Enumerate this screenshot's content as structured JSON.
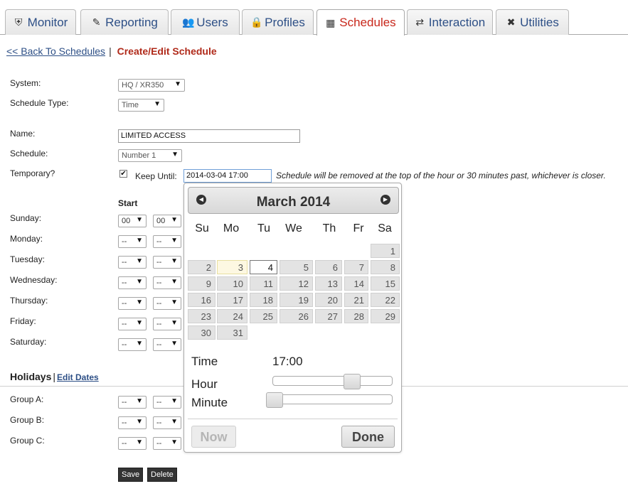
{
  "tabs": [
    {
      "label": "Monitor",
      "icon": "shield-icon",
      "glyph": "⛨",
      "active": false
    },
    {
      "label": "Reporting",
      "icon": "reporting-icon",
      "glyph": "✎",
      "active": false
    },
    {
      "label": "Users",
      "icon": "users-icon",
      "glyph": "👥",
      "active": false
    },
    {
      "label": "Profiles",
      "icon": "lock-icon",
      "glyph": "🔒",
      "active": false
    },
    {
      "label": "Schedules",
      "icon": "calendar-icon",
      "glyph": "▦",
      "active": true
    },
    {
      "label": "Interaction",
      "icon": "interaction-icon",
      "glyph": "⇄",
      "active": false
    },
    {
      "label": "Utilities",
      "icon": "tools-icon",
      "glyph": "✖",
      "active": false
    }
  ],
  "breadcrumb": {
    "back": "<< Back To Schedules",
    "separator": "|",
    "current": "Create/Edit Schedule"
  },
  "form": {
    "system_label": "System:",
    "system_value": "HQ / XR350",
    "type_label": "Schedule Type:",
    "type_value": "Time",
    "name_label": "Name:",
    "name_value": "LIMITED ACCESS",
    "schedule_label": "Schedule:",
    "schedule_value": "Number 1",
    "temporary_label": "Temporary?",
    "temporary_checked": "✔",
    "keep_until_label": "Keep Until:",
    "keep_until_value": "2014-03-04 17:00",
    "note": "Schedule will be removed at the top of the hour or 30 minutes past, whichever is closer.",
    "start_header": "Start",
    "days": [
      {
        "label": "Sunday:",
        "hour": "00",
        "minute": "00"
      },
      {
        "label": "Monday:",
        "hour": "--",
        "minute": "--"
      },
      {
        "label": "Tuesday:",
        "hour": "--",
        "minute": "--"
      },
      {
        "label": "Wednesday:",
        "hour": "--",
        "minute": "--"
      },
      {
        "label": "Thursday:",
        "hour": "--",
        "minute": "--"
      },
      {
        "label": "Friday:",
        "hour": "--",
        "minute": "--"
      },
      {
        "label": "Saturday:",
        "hour": "--",
        "minute": "--"
      }
    ],
    "holidays_title": "Holidays",
    "holidays_sep": "|",
    "edit_dates": "Edit Dates",
    "groups": [
      {
        "label": "Group A:",
        "hour": "--",
        "minute": "--"
      },
      {
        "label": "Group B:",
        "hour": "--",
        "minute": "--"
      },
      {
        "label": "Group C:",
        "hour": "--",
        "minute": "--"
      }
    ],
    "save": "Save",
    "delete": "Delete",
    "arrow": "▼"
  },
  "datepicker": {
    "title": "March 2014",
    "prev": "◀",
    "next": "▶",
    "weekdays": [
      "Su",
      "Mo",
      "Tu",
      "We",
      "Th",
      "Fr",
      "Sa"
    ],
    "first_weekday_index": 6,
    "days_in_month": 31,
    "today": 3,
    "selected": 4,
    "time_label": "Time",
    "time_value": "17:00",
    "hour_label": "Hour",
    "minute_label": "Minute",
    "hour_value": 17,
    "minute_value": 0,
    "now": "Now",
    "done": "Done"
  }
}
